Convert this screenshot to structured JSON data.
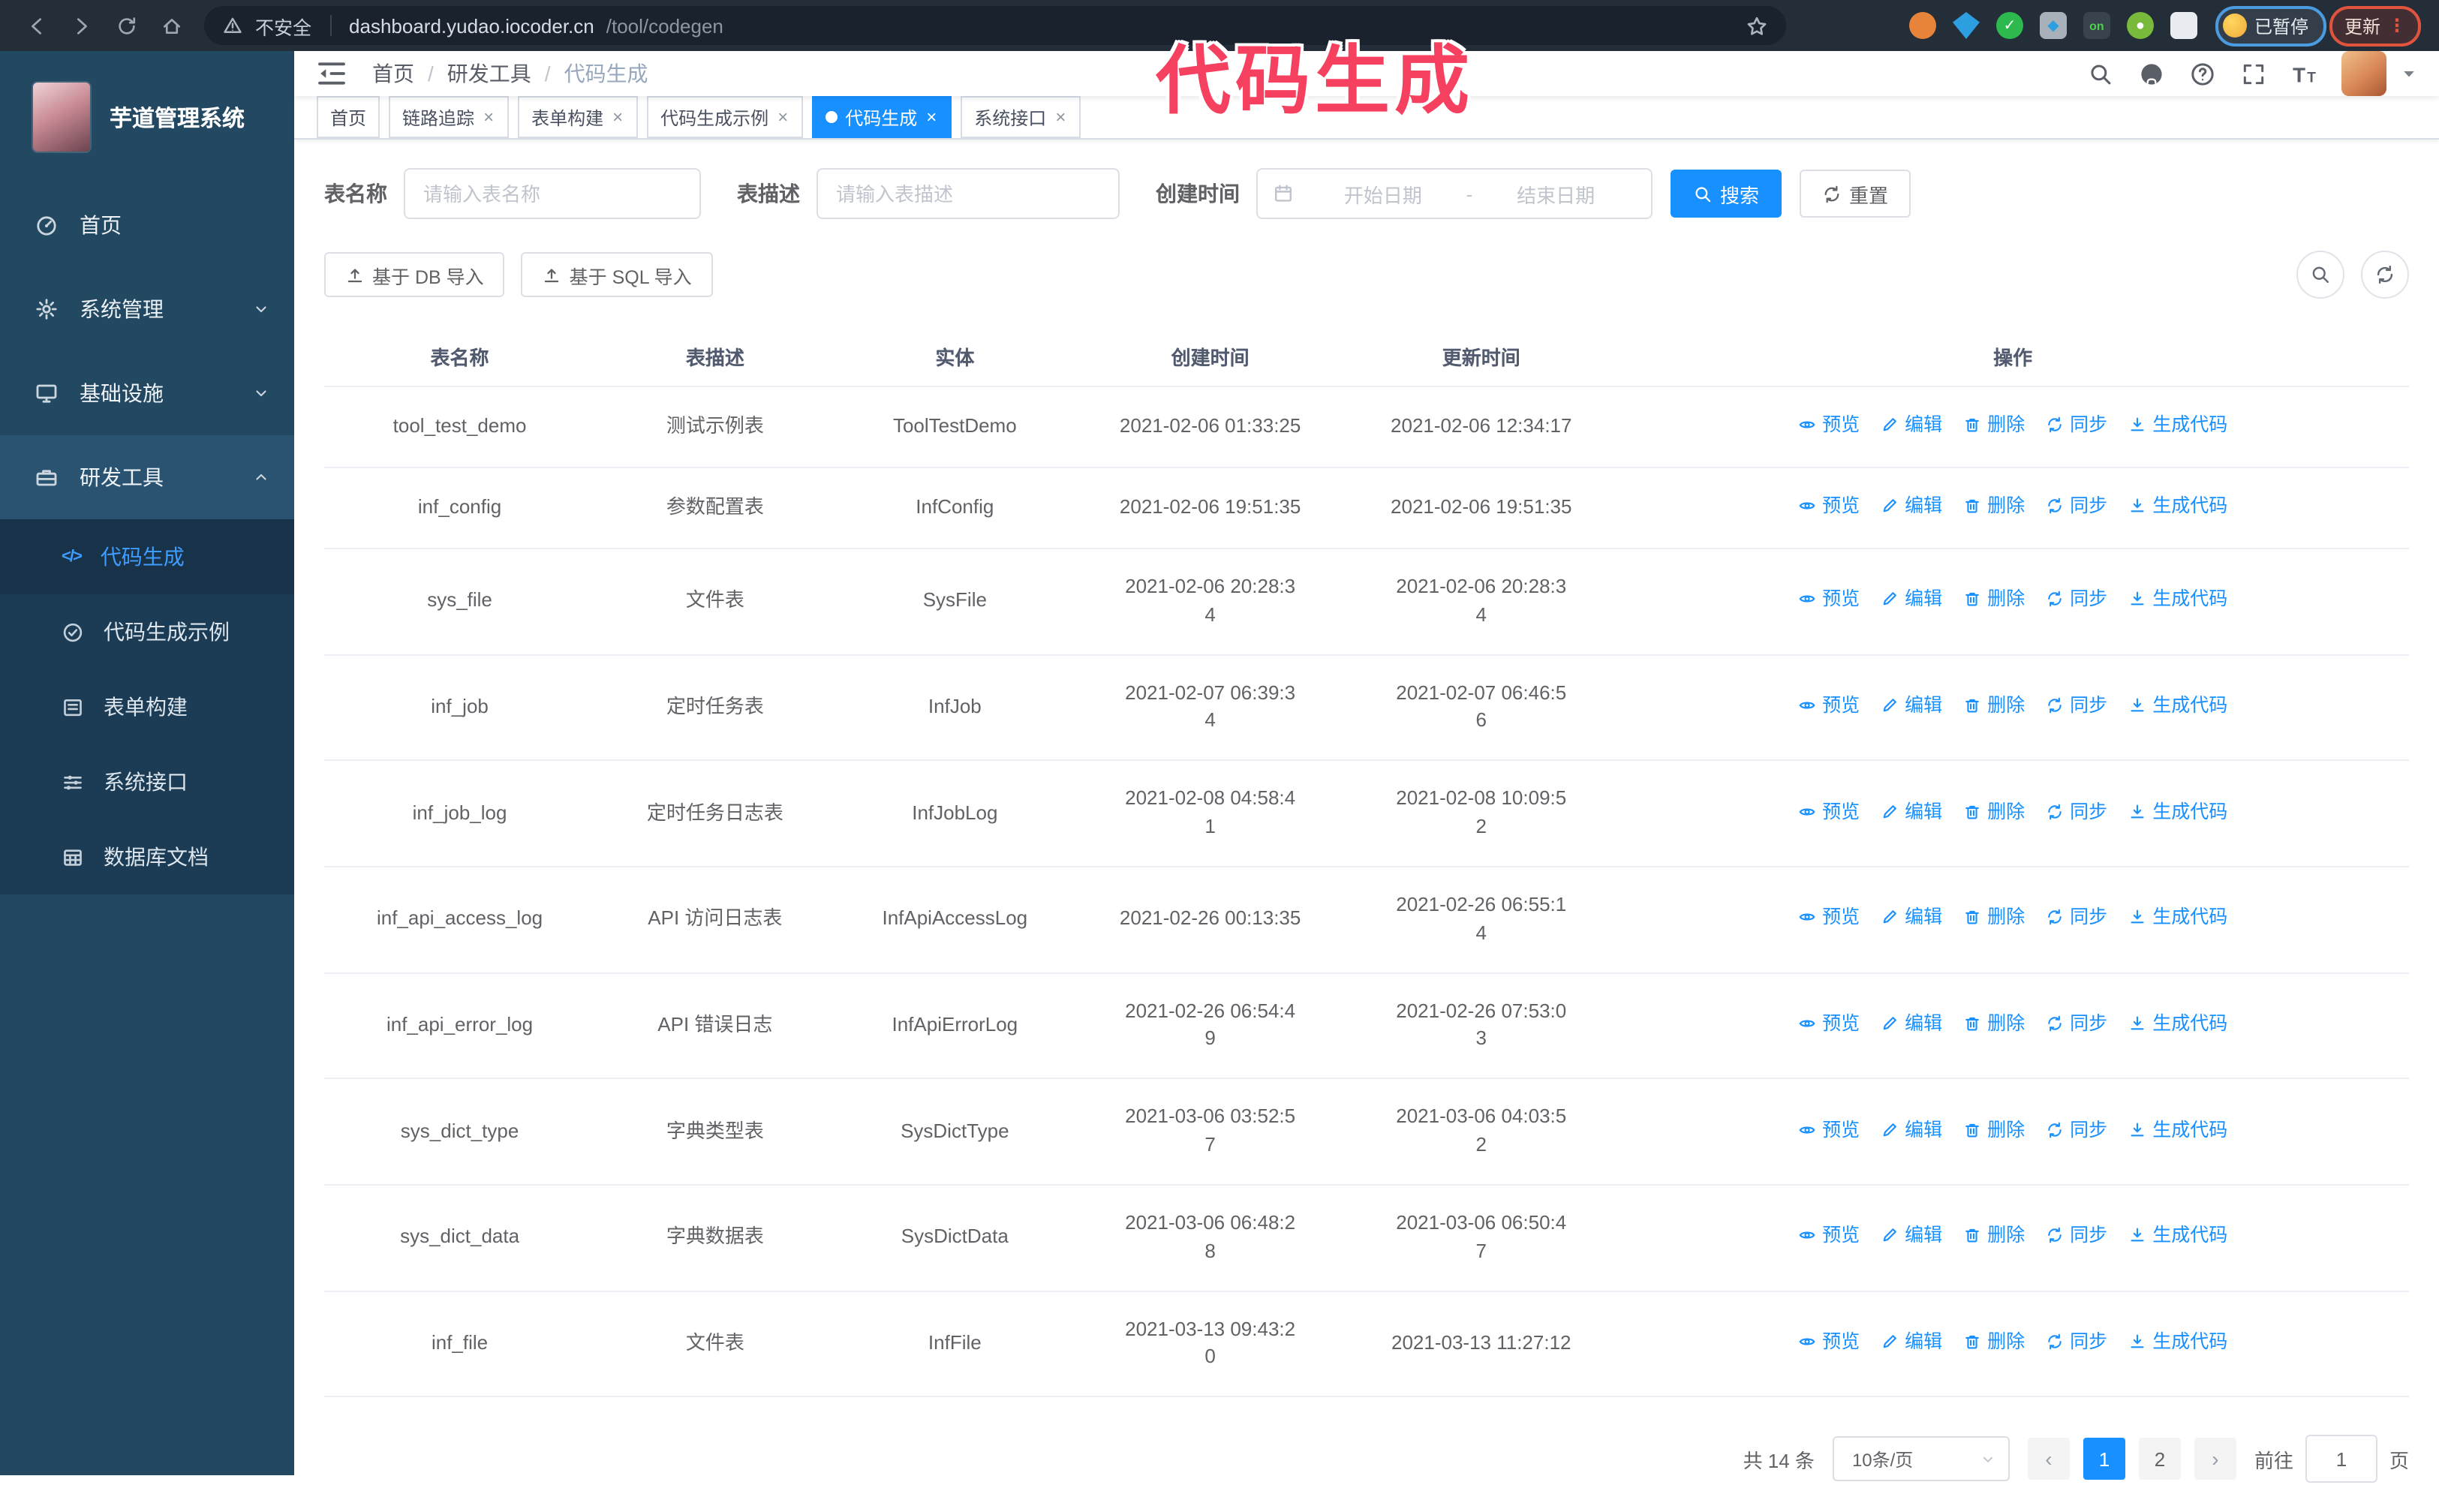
{
  "annotation": {
    "text": "代码生成",
    "color": "#f6405f"
  },
  "browser": {
    "security_label": "不安全",
    "url_host": "dashboard.yudao.iocoder.cn",
    "url_path": "/tool/codegen",
    "paused_badge": "已暂停",
    "update_button": "更新",
    "extensions": [
      "orange-extension-icon",
      "blue-gem-extension-icon",
      "green-check-extension-icon",
      "gray-grid-extension-icon",
      "dark-on-extension-icon",
      "green-person-extension-icon",
      "white-puzzle-extension-icon"
    ]
  },
  "sidebar": {
    "app_title": "芋道管理系统",
    "items": [
      {
        "key": "home",
        "label": "首页",
        "icon": "dashboard-icon"
      },
      {
        "key": "system",
        "label": "系统管理",
        "icon": "gear-icon",
        "expandable": true
      },
      {
        "key": "infra",
        "label": "基础设施",
        "icon": "monitor-icon",
        "expandable": true
      },
      {
        "key": "devtools",
        "label": "研发工具",
        "icon": "toolbox-icon",
        "expanded": true
      }
    ],
    "submenu": [
      {
        "key": "codegen",
        "label": "代码生成",
        "icon": "code-icon",
        "active": true
      },
      {
        "key": "codegen-demo",
        "label": "代码生成示例",
        "icon": "badge-check-icon"
      },
      {
        "key": "form-builder",
        "label": "表单构建",
        "icon": "form-icon"
      },
      {
        "key": "system-api",
        "label": "系统接口",
        "icon": "sliders-icon"
      },
      {
        "key": "db-doc",
        "label": "数据库文档",
        "icon": "dbdoc-icon"
      }
    ]
  },
  "navbar": {
    "breadcrumb": [
      {
        "label": "首页"
      },
      {
        "label": "研发工具"
      },
      {
        "label": "代码生成"
      }
    ],
    "right_icons": [
      "search-icon",
      "github-icon",
      "question-icon",
      "fullscreen-icon",
      "fontsize-icon"
    ]
  },
  "tabs": [
    {
      "label": "首页",
      "closable": false
    },
    {
      "label": "链路追踪",
      "closable": true
    },
    {
      "label": "表单构建",
      "closable": true
    },
    {
      "label": "代码生成示例",
      "closable": true
    },
    {
      "label": "代码生成",
      "closable": true,
      "active": true
    },
    {
      "label": "系统接口",
      "closable": true
    }
  ],
  "filters": {
    "table_name_label": "表名称",
    "table_name_placeholder": "请输入表名称",
    "table_desc_label": "表描述",
    "table_desc_placeholder": "请输入表描述",
    "create_time_label": "创建时间",
    "start_placeholder": "开始日期",
    "range_separator": "-",
    "end_placeholder": "结束日期",
    "search_label": "搜索",
    "reset_label": "重置"
  },
  "toolbar": {
    "import_db_label": "基于 DB 导入",
    "import_sql_label": "基于 SQL 导入"
  },
  "table": {
    "headers": [
      "表名称",
      "表描述",
      "实体",
      "创建时间",
      "更新时间",
      "操作"
    ],
    "actions": [
      {
        "key": "preview",
        "label": "预览",
        "icon": "eye-icon"
      },
      {
        "key": "edit",
        "label": "编辑",
        "icon": "edit-icon"
      },
      {
        "key": "delete",
        "label": "删除",
        "icon": "delete-icon"
      },
      {
        "key": "sync",
        "label": "同步",
        "icon": "sync-icon"
      },
      {
        "key": "generate",
        "label": "生成代码",
        "icon": "download-icon"
      }
    ],
    "rows": [
      {
        "name": "tool_test_demo",
        "desc": "测试示例表",
        "entity": "ToolTestDemo",
        "created": "2021-02-06 01:33:25",
        "updated": "2021-02-06 12:34:17"
      },
      {
        "name": "inf_config",
        "desc": "参数配置表",
        "entity": "InfConfig",
        "created": "2021-02-06 19:51:35",
        "updated": "2021-02-06 19:51:35"
      },
      {
        "name": "sys_file",
        "desc": "文件表",
        "entity": "SysFile",
        "created": "2021-02-06 20:28:3\n4",
        "updated": "2021-02-06 20:28:3\n4"
      },
      {
        "name": "inf_job",
        "desc": "定时任务表",
        "entity": "InfJob",
        "created": "2021-02-07 06:39:3\n4",
        "updated": "2021-02-07 06:46:5\n6"
      },
      {
        "name": "inf_job_log",
        "desc": "定时任务日志表",
        "entity": "InfJobLog",
        "created": "2021-02-08 04:58:4\n1",
        "updated": "2021-02-08 10:09:5\n2"
      },
      {
        "name": "inf_api_access_log",
        "desc": "API 访问日志表",
        "entity": "InfApiAccessLog",
        "created": "2021-02-26 00:13:35",
        "updated": "2021-02-26 06:55:1\n4"
      },
      {
        "name": "inf_api_error_log",
        "desc": "API 错误日志",
        "entity": "InfApiErrorLog",
        "created": "2021-02-26 06:54:4\n9",
        "updated": "2021-02-26 07:53:0\n3"
      },
      {
        "name": "sys_dict_type",
        "desc": "字典类型表",
        "entity": "SysDictType",
        "created": "2021-03-06 03:52:5\n7",
        "updated": "2021-03-06 04:03:5\n2"
      },
      {
        "name": "sys_dict_data",
        "desc": "字典数据表",
        "entity": "SysDictData",
        "created": "2021-03-06 06:48:2\n8",
        "updated": "2021-03-06 06:50:4\n7"
      },
      {
        "name": "inf_file",
        "desc": "文件表",
        "entity": "InfFile",
        "created": "2021-03-13 09:43:2\n0",
        "updated": "2021-03-13 11:27:12"
      }
    ]
  },
  "pagination": {
    "total_text": "共 14 条",
    "page_size_text": "10条/页",
    "pages": [
      "1",
      "2"
    ],
    "active_page": "1",
    "prev_label": "‹",
    "next_label": "›",
    "goto_prefix": "前往",
    "goto_value": "1",
    "goto_suffix": "页"
  }
}
